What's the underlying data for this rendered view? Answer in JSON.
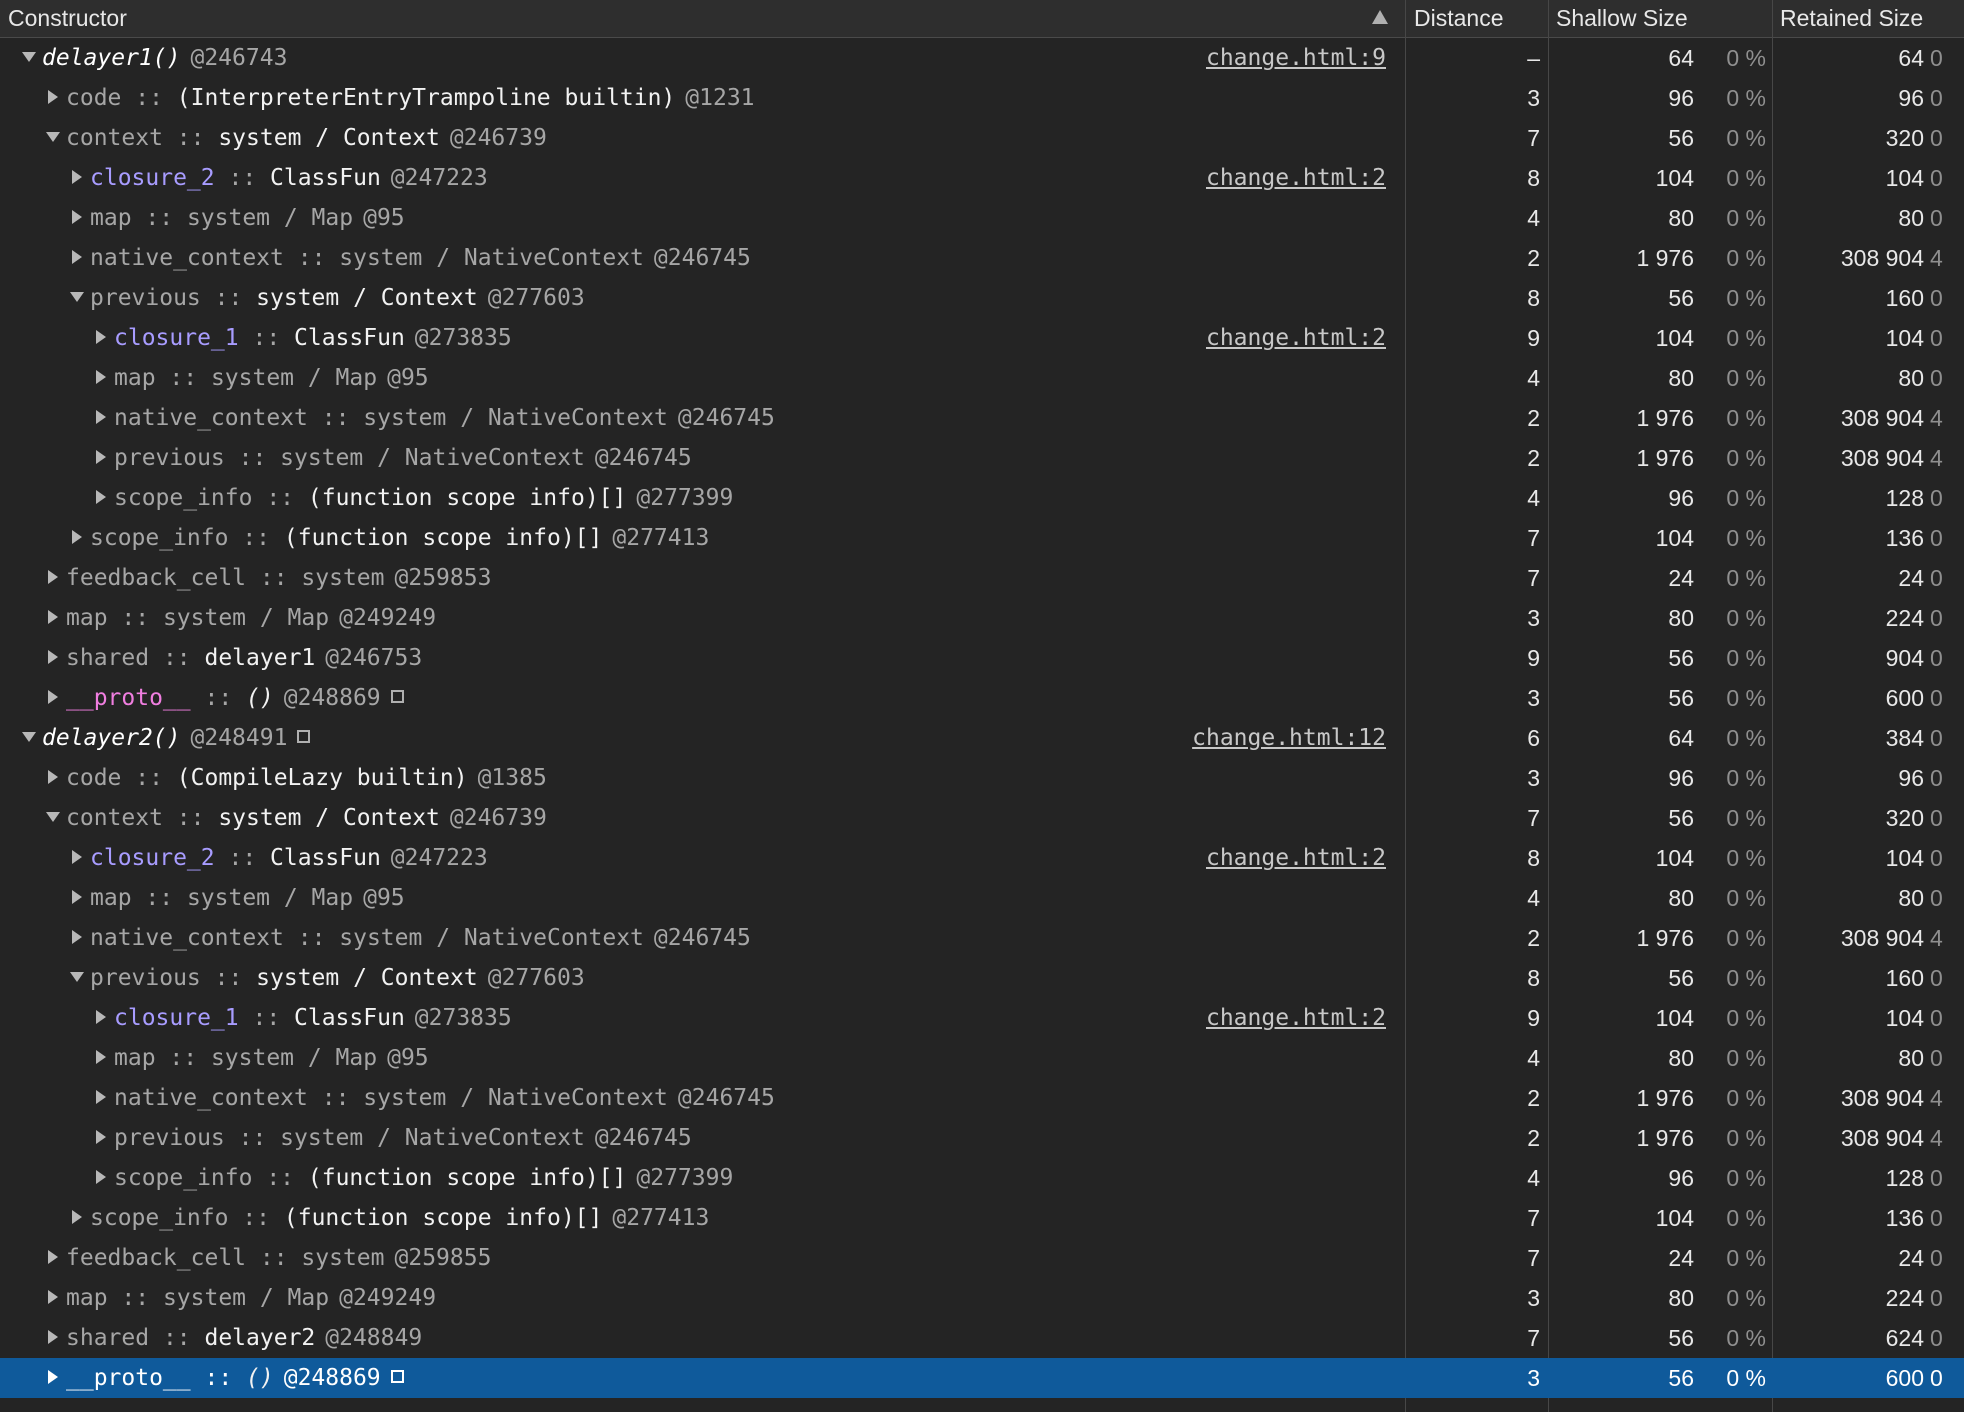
{
  "columns": {
    "constructor": "Constructor",
    "distance": "Distance",
    "shallow": "Shallow Size",
    "retained": "Retained Size"
  },
  "rows": [
    {
      "depth": 0,
      "expanded": true,
      "style": "fn",
      "name": "delayer1()",
      "sep": "",
      "type": "",
      "id": "@246743",
      "box": false,
      "link": "change.html:9",
      "distance": "–",
      "shallow": "64",
      "shallow_pct": "0 %",
      "retained": "64",
      "retained_pct": "0"
    },
    {
      "depth": 1,
      "expanded": false,
      "style": "dim",
      "name": "code",
      "sep": " :: ",
      "type": "(InterpreterEntryTrampoline builtin)",
      "id": "@1231",
      "box": false,
      "link": "",
      "distance": "3",
      "shallow": "96",
      "shallow_pct": "0 %",
      "retained": "96",
      "retained_pct": "0"
    },
    {
      "depth": 1,
      "expanded": true,
      "style": "dim",
      "name": "context",
      "sep": " :: ",
      "type": "system / Context",
      "id": "@246739",
      "box": false,
      "link": "",
      "distance": "7",
      "shallow": "56",
      "shallow_pct": "0 %",
      "retained": "320",
      "retained_pct": "0"
    },
    {
      "depth": 2,
      "expanded": false,
      "style": "purple",
      "name": "closure_2",
      "sep": " :: ",
      "type": "ClassFun",
      "id": "@247223",
      "box": false,
      "link": "change.html:2",
      "distance": "8",
      "shallow": "104",
      "shallow_pct": "0 %",
      "retained": "104",
      "retained_pct": "0"
    },
    {
      "depth": 2,
      "expanded": false,
      "style": "dimall",
      "name": "map",
      "sep": " :: ",
      "type": "system / Map",
      "id": "@95",
      "box": false,
      "link": "",
      "distance": "4",
      "shallow": "80",
      "shallow_pct": "0 %",
      "retained": "80",
      "retained_pct": "0"
    },
    {
      "depth": 2,
      "expanded": false,
      "style": "dimall",
      "name": "native_context",
      "sep": " :: ",
      "type": "system / NativeContext",
      "id": "@246745",
      "box": false,
      "link": "",
      "distance": "2",
      "shallow": "1 976",
      "shallow_pct": "0 %",
      "retained": "308 904",
      "retained_pct": "4"
    },
    {
      "depth": 2,
      "expanded": true,
      "style": "dim",
      "name": "previous",
      "sep": " :: ",
      "type": "system / Context",
      "id": "@277603",
      "box": false,
      "link": "",
      "distance": "8",
      "shallow": "56",
      "shallow_pct": "0 %",
      "retained": "160",
      "retained_pct": "0"
    },
    {
      "depth": 3,
      "expanded": false,
      "style": "purple",
      "name": "closure_1",
      "sep": " :: ",
      "type": "ClassFun",
      "id": "@273835",
      "box": false,
      "link": "change.html:2",
      "distance": "9",
      "shallow": "104",
      "shallow_pct": "0 %",
      "retained": "104",
      "retained_pct": "0"
    },
    {
      "depth": 3,
      "expanded": false,
      "style": "dimall",
      "name": "map",
      "sep": " :: ",
      "type": "system / Map",
      "id": "@95",
      "box": false,
      "link": "",
      "distance": "4",
      "shallow": "80",
      "shallow_pct": "0 %",
      "retained": "80",
      "retained_pct": "0"
    },
    {
      "depth": 3,
      "expanded": false,
      "style": "dimall",
      "name": "native_context",
      "sep": " :: ",
      "type": "system / NativeContext",
      "id": "@246745",
      "box": false,
      "link": "",
      "distance": "2",
      "shallow": "1 976",
      "shallow_pct": "0 %",
      "retained": "308 904",
      "retained_pct": "4"
    },
    {
      "depth": 3,
      "expanded": false,
      "style": "dimall",
      "name": "previous",
      "sep": " :: ",
      "type": "system / NativeContext",
      "id": "@246745",
      "box": false,
      "link": "",
      "distance": "2",
      "shallow": "1 976",
      "shallow_pct": "0 %",
      "retained": "308 904",
      "retained_pct": "4"
    },
    {
      "depth": 3,
      "expanded": false,
      "style": "dim",
      "name": "scope_info",
      "sep": " :: ",
      "type": "(function scope info)[]",
      "id": "@277399",
      "box": false,
      "link": "",
      "distance": "4",
      "shallow": "96",
      "shallow_pct": "0 %",
      "retained": "128",
      "retained_pct": "0"
    },
    {
      "depth": 2,
      "expanded": false,
      "style": "dim",
      "name": "scope_info",
      "sep": " :: ",
      "type": "(function scope info)[]",
      "id": "@277413",
      "box": false,
      "link": "",
      "distance": "7",
      "shallow": "104",
      "shallow_pct": "0 %",
      "retained": "136",
      "retained_pct": "0"
    },
    {
      "depth": 1,
      "expanded": false,
      "style": "dimall",
      "name": "feedback_cell",
      "sep": " :: ",
      "type": "system",
      "id": "@259853",
      "box": false,
      "link": "",
      "distance": "7",
      "shallow": "24",
      "shallow_pct": "0 %",
      "retained": "24",
      "retained_pct": "0"
    },
    {
      "depth": 1,
      "expanded": false,
      "style": "dimall",
      "name": "map",
      "sep": " :: ",
      "type": "system / Map",
      "id": "@249249",
      "box": false,
      "link": "",
      "distance": "3",
      "shallow": "80",
      "shallow_pct": "0 %",
      "retained": "224",
      "retained_pct": "0"
    },
    {
      "depth": 1,
      "expanded": false,
      "style": "dim",
      "name": "shared",
      "sep": " :: ",
      "type": "delayer1",
      "id": "@246753",
      "box": false,
      "link": "",
      "distance": "9",
      "shallow": "56",
      "shallow_pct": "0 %",
      "retained": "904",
      "retained_pct": "0"
    },
    {
      "depth": 1,
      "expanded": false,
      "style": "proto",
      "name": "__proto__",
      "sep": " :: ",
      "type": "()",
      "id": "@248869",
      "box": true,
      "link": "",
      "distance": "3",
      "shallow": "56",
      "shallow_pct": "0 %",
      "retained": "600",
      "retained_pct": "0"
    },
    {
      "depth": 0,
      "expanded": true,
      "style": "fn",
      "name": "delayer2()",
      "sep": "",
      "type": "",
      "id": "@248491",
      "box": true,
      "link": "change.html:12",
      "distance": "6",
      "shallow": "64",
      "shallow_pct": "0 %",
      "retained": "384",
      "retained_pct": "0"
    },
    {
      "depth": 1,
      "expanded": false,
      "style": "dim",
      "name": "code",
      "sep": " :: ",
      "type": "(CompileLazy builtin)",
      "id": "@1385",
      "box": false,
      "link": "",
      "distance": "3",
      "shallow": "96",
      "shallow_pct": "0 %",
      "retained": "96",
      "retained_pct": "0"
    },
    {
      "depth": 1,
      "expanded": true,
      "style": "dim",
      "name": "context",
      "sep": " :: ",
      "type": "system / Context",
      "id": "@246739",
      "box": false,
      "link": "",
      "distance": "7",
      "shallow": "56",
      "shallow_pct": "0 %",
      "retained": "320",
      "retained_pct": "0"
    },
    {
      "depth": 2,
      "expanded": false,
      "style": "purple",
      "name": "closure_2",
      "sep": " :: ",
      "type": "ClassFun",
      "id": "@247223",
      "box": false,
      "link": "change.html:2",
      "distance": "8",
      "shallow": "104",
      "shallow_pct": "0 %",
      "retained": "104",
      "retained_pct": "0"
    },
    {
      "depth": 2,
      "expanded": false,
      "style": "dimall",
      "name": "map",
      "sep": " :: ",
      "type": "system / Map",
      "id": "@95",
      "box": false,
      "link": "",
      "distance": "4",
      "shallow": "80",
      "shallow_pct": "0 %",
      "retained": "80",
      "retained_pct": "0"
    },
    {
      "depth": 2,
      "expanded": false,
      "style": "dimall",
      "name": "native_context",
      "sep": " :: ",
      "type": "system / NativeContext",
      "id": "@246745",
      "box": false,
      "link": "",
      "distance": "2",
      "shallow": "1 976",
      "shallow_pct": "0 %",
      "retained": "308 904",
      "retained_pct": "4"
    },
    {
      "depth": 2,
      "expanded": true,
      "style": "dim",
      "name": "previous",
      "sep": " :: ",
      "type": "system / Context",
      "id": "@277603",
      "box": false,
      "link": "",
      "distance": "8",
      "shallow": "56",
      "shallow_pct": "0 %",
      "retained": "160",
      "retained_pct": "0"
    },
    {
      "depth": 3,
      "expanded": false,
      "style": "purple",
      "name": "closure_1",
      "sep": " :: ",
      "type": "ClassFun",
      "id": "@273835",
      "box": false,
      "link": "change.html:2",
      "distance": "9",
      "shallow": "104",
      "shallow_pct": "0 %",
      "retained": "104",
      "retained_pct": "0"
    },
    {
      "depth": 3,
      "expanded": false,
      "style": "dimall",
      "name": "map",
      "sep": " :: ",
      "type": "system / Map",
      "id": "@95",
      "box": false,
      "link": "",
      "distance": "4",
      "shallow": "80",
      "shallow_pct": "0 %",
      "retained": "80",
      "retained_pct": "0"
    },
    {
      "depth": 3,
      "expanded": false,
      "style": "dimall",
      "name": "native_context",
      "sep": " :: ",
      "type": "system / NativeContext",
      "id": "@246745",
      "box": false,
      "link": "",
      "distance": "2",
      "shallow": "1 976",
      "shallow_pct": "0 %",
      "retained": "308 904",
      "retained_pct": "4"
    },
    {
      "depth": 3,
      "expanded": false,
      "style": "dimall",
      "name": "previous",
      "sep": " :: ",
      "type": "system / NativeContext",
      "id": "@246745",
      "box": false,
      "link": "",
      "distance": "2",
      "shallow": "1 976",
      "shallow_pct": "0 %",
      "retained": "308 904",
      "retained_pct": "4"
    },
    {
      "depth": 3,
      "expanded": false,
      "style": "dim",
      "name": "scope_info",
      "sep": " :: ",
      "type": "(function scope info)[]",
      "id": "@277399",
      "box": false,
      "link": "",
      "distance": "4",
      "shallow": "96",
      "shallow_pct": "0 %",
      "retained": "128",
      "retained_pct": "0"
    },
    {
      "depth": 2,
      "expanded": false,
      "style": "dim",
      "name": "scope_info",
      "sep": " :: ",
      "type": "(function scope info)[]",
      "id": "@277413",
      "box": false,
      "link": "",
      "distance": "7",
      "shallow": "104",
      "shallow_pct": "0 %",
      "retained": "136",
      "retained_pct": "0"
    },
    {
      "depth": 1,
      "expanded": false,
      "style": "dimall",
      "name": "feedback_cell",
      "sep": " :: ",
      "type": "system",
      "id": "@259855",
      "box": false,
      "link": "",
      "distance": "7",
      "shallow": "24",
      "shallow_pct": "0 %",
      "retained": "24",
      "retained_pct": "0"
    },
    {
      "depth": 1,
      "expanded": false,
      "style": "dimall",
      "name": "map",
      "sep": " :: ",
      "type": "system / Map",
      "id": "@249249",
      "box": false,
      "link": "",
      "distance": "3",
      "shallow": "80",
      "shallow_pct": "0 %",
      "retained": "224",
      "retained_pct": "0"
    },
    {
      "depth": 1,
      "expanded": false,
      "style": "dim",
      "name": "shared",
      "sep": " :: ",
      "type": "delayer2",
      "id": "@248849",
      "box": false,
      "link": "",
      "distance": "7",
      "shallow": "56",
      "shallow_pct": "0 %",
      "retained": "624",
      "retained_pct": "0"
    },
    {
      "depth": 1,
      "expanded": false,
      "style": "proto",
      "name": "__proto__",
      "sep": " :: ",
      "type": "()",
      "id": "@248869",
      "box": true,
      "link": "",
      "distance": "3",
      "shallow": "56",
      "shallow_pct": "0 %",
      "retained": "600",
      "retained_pct": "0",
      "selected": true
    }
  ]
}
